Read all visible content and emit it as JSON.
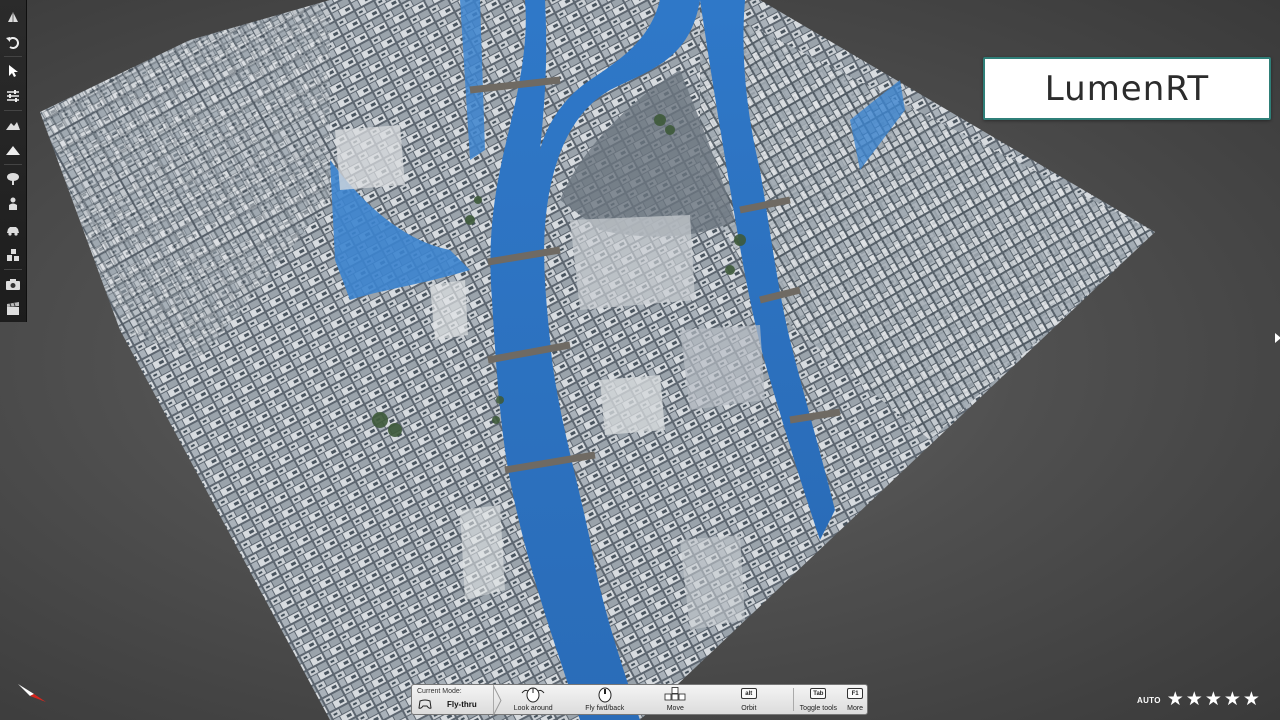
{
  "app": {
    "logo_text": "LumenRT"
  },
  "toolbar": {
    "items": [
      {
        "name": "view-icon"
      },
      {
        "name": "undo-icon"
      },
      {
        "name": "select-icon"
      },
      {
        "name": "settings-sliders-icon"
      },
      {
        "name": "terrain-icon"
      },
      {
        "name": "mountain-icon"
      },
      {
        "name": "tree-icon"
      },
      {
        "name": "person-icon"
      },
      {
        "name": "car-icon"
      },
      {
        "name": "objects-icon"
      },
      {
        "name": "camera-icon"
      },
      {
        "name": "clapper-icon"
      }
    ]
  },
  "control_bar": {
    "current_mode_label": "Current Mode:",
    "current_mode_value": "Fly-thru",
    "controls": [
      {
        "label": "Look around",
        "icon": "mouse-look-icon"
      },
      {
        "label": "Fly fwd/back",
        "icon": "mouse-wheel-icon"
      },
      {
        "label": "Move",
        "icon": "arrow-keys-icon"
      },
      {
        "label": "Orbit",
        "key": "alt"
      },
      {
        "label": "Toggle tools",
        "key": "Tab"
      },
      {
        "label": "More",
        "key": "F1"
      }
    ]
  },
  "quality": {
    "label": "AUTO",
    "stars": 5
  },
  "colors": {
    "river": "#2d74c4",
    "background": "#505050",
    "logo_border": "#2f7f78"
  }
}
